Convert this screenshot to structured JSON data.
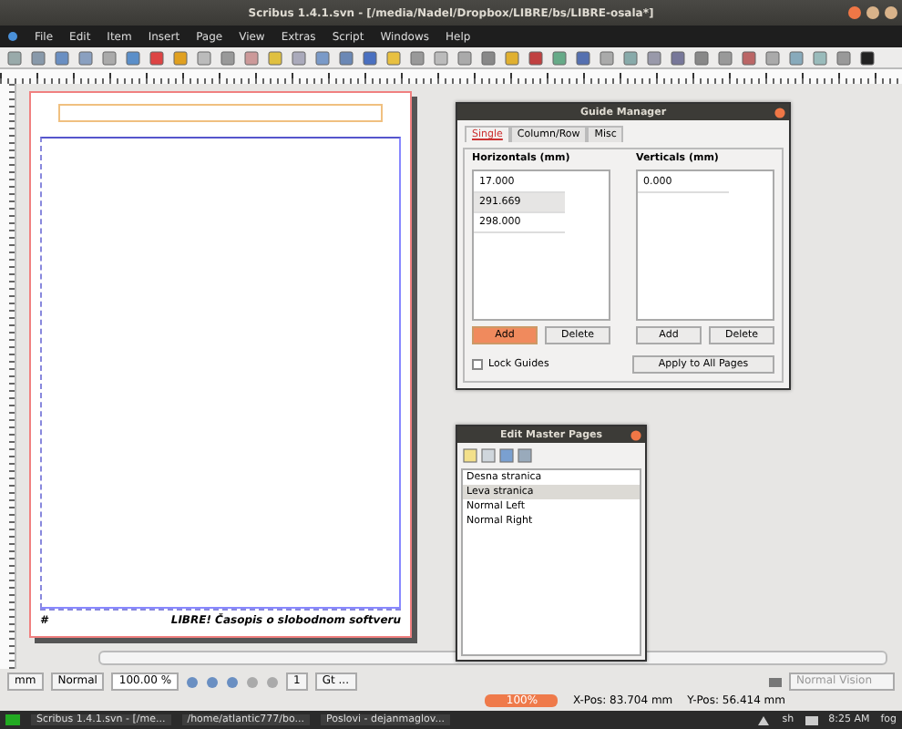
{
  "window": {
    "title": "Scribus 1.4.1.svn - [/media/Nadel/Dropbox/LIBRE/bs/LIBRE-osala*]"
  },
  "menu": [
    "File",
    "Edit",
    "Item",
    "Insert",
    "Page",
    "View",
    "Extras",
    "Script",
    "Windows",
    "Help"
  ],
  "page": {
    "footer_text": "LIBRE! Časopis o slobodnom softveru",
    "page_number": "#"
  },
  "guide_manager": {
    "title": "Guide Manager",
    "tabs": [
      {
        "label": "Single",
        "selected": true
      },
      {
        "label": "Column/Row",
        "selected": false
      },
      {
        "label": "Misc",
        "selected": false
      }
    ],
    "horizontals_label": "Horizontals (mm)",
    "horizontals": [
      {
        "value": "17.000",
        "selected": false
      },
      {
        "value": "291.669",
        "selected": true
      },
      {
        "value": "298.000",
        "selected": false
      }
    ],
    "verticals_label": "Verticals (mm)",
    "verticals": [
      {
        "value": "0.000",
        "selected": false
      }
    ],
    "horizontal_buttons": [
      {
        "label": "Add",
        "kind": "default"
      },
      {
        "label": "Delete",
        "kind": "normal"
      }
    ],
    "vertical_buttons": [
      {
        "label": "Add",
        "kind": "normal"
      },
      {
        "label": "Delete",
        "kind": "normal"
      }
    ],
    "lock_guides": {
      "label": "Lock Guides",
      "checked": false
    },
    "apply_button": "Apply to All Pages"
  },
  "master_pages": {
    "title": "Edit Master Pages",
    "items": [
      {
        "label": "Desna stranica",
        "selected": false
      },
      {
        "label": "Leva stranica",
        "selected": true
      },
      {
        "label": "Normal Left",
        "selected": false
      },
      {
        "label": "Normal Right",
        "selected": false
      }
    ]
  },
  "status": {
    "unit": "mm",
    "style": "Normal",
    "zoom": "100.00 %",
    "page": "1",
    "layer": "Gt ...",
    "vision": "Normal Vision",
    "progress": {
      "level": 1,
      "reading": "100%"
    },
    "x_pos": "X-Pos: 83.704 mm",
    "y_pos": "Y-Pos: 56.414 mm"
  },
  "taskbar": {
    "tasks": [
      "Scribus 1.4.1.svn - [/me...",
      "/home/atlantic777/bo...",
      "Poslovi - dejanmaglov..."
    ],
    "indicator": "sh",
    "clock": "8:25 AM",
    "user": "fog"
  }
}
